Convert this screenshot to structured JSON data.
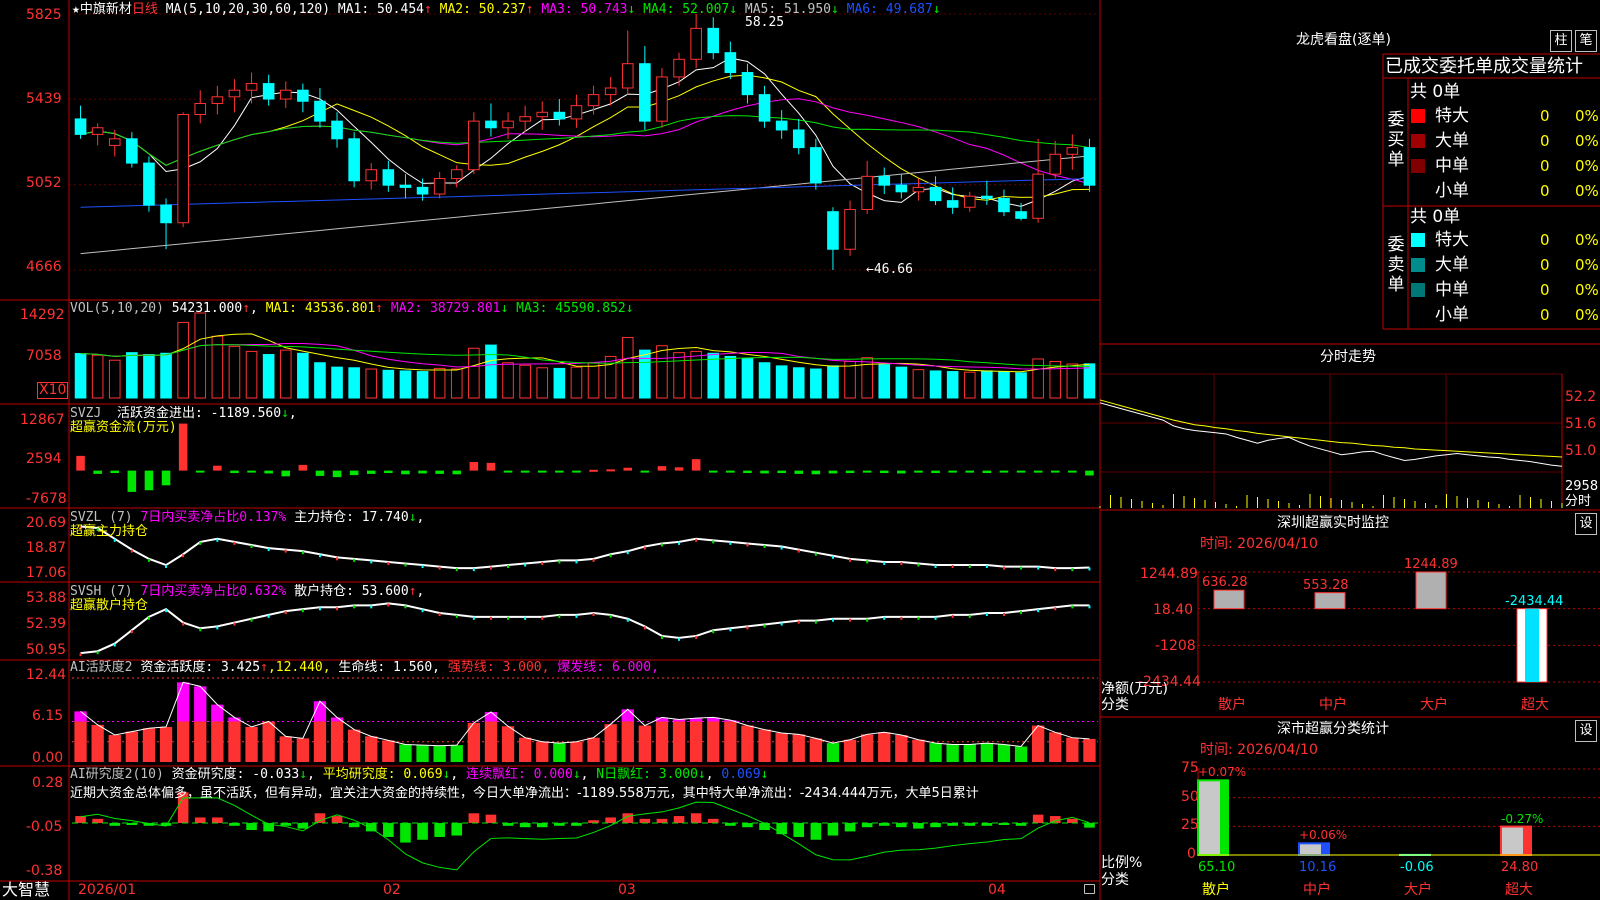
{
  "colors": {
    "up": "#ff3232",
    "down": "#00ffff",
    "bg": "#000000",
    "frame": "#c00000",
    "ma1": "#ffffff",
    "ma2": "#ffff00",
    "ma3": "#ff00ff",
    "ma4": "#00e600",
    "ma5": "#c0c0c0",
    "ma6": "#1e50ff",
    "magenta": "#ff00ff",
    "green": "#00e600"
  },
  "main": {
    "title_icon": "★",
    "stock": "中旗新材",
    "period": "日线",
    "ma_spec": "MA(5,10,20,30,60,120)",
    "ma1": "MA1: 50.454",
    "ma2": "MA2: 50.237",
    "ma3": "MA3: 50.743",
    "ma4": "MA4: 52.007",
    "ma5": "MA5: 51.950",
    "ma6": "MA6: 49.687",
    "ma1_arrow": "↑",
    "ma2_arrow": "↑",
    "ma3_arrow": "↓",
    "ma4_arrow": "↓",
    "ma5_arrow": "↓",
    "ma6_arrow": "↓",
    "hi_label": "58.25",
    "lo_label": "←46.66",
    "y_ticks": [
      "5825",
      "5439",
      "5052",
      "4666"
    ]
  },
  "vol": {
    "spec": "VOL(5,10,20)",
    "value": "54231.000",
    "arrow": "↑",
    "ma1": "MA1: 43536.801",
    "ma1_arrow": "↑",
    "ma2": "MA2: 38729.801",
    "ma2_arrow": "↓",
    "ma3": "MA3: 45590.852",
    "ma3_arrow": "↓",
    "y_ticks": [
      "14292",
      "7058"
    ],
    "unit": "X10"
  },
  "svzj": {
    "name": "SVZJ",
    "label": "活跃资金进出: -1189.560",
    "arrow": "↓",
    "suffix": ",",
    "sub": "超赢资金流(万元)",
    "y_ticks": [
      "12867",
      "2594",
      "-7678"
    ]
  },
  "svzl": {
    "name": "SVZL (7)",
    "label": "7日内买卖净占比0.137%",
    "hold": "主力持仓: 17.740",
    "arrow": "↓",
    "suffix": ",",
    "sub": "超赢主力持仓",
    "y_ticks": [
      "20.69",
      "18.87",
      "17.06"
    ]
  },
  "svsh": {
    "name": "SVSH (7)",
    "label": "7日内买卖净占比0.632%",
    "hold": "散户持仓: 53.600",
    "arrow": "↑",
    "suffix": ",",
    "sub": "超赢散户持仓",
    "y_ticks": [
      "53.88",
      "52.39",
      "50.95"
    ]
  },
  "ai1": {
    "name": "AI活跃度2",
    "a": "资金活跃度: 3.425",
    "a_arrow": "↑",
    "b": ",12.440,",
    "c": "生命线: 1.560,",
    "d": "强势线: 3.000,",
    "e": "爆发线: 6.000,",
    "y_ticks": [
      "12.44",
      "6.15",
      "0.00"
    ]
  },
  "ai2": {
    "name": "AI研究度2(10)",
    "a": "资金研究度: -0.033",
    "a_arrow": "↓",
    "b": "平均研究度: 0.069",
    "b_arrow": "↓",
    "c": "连续飘红: 0.000",
    "c_arrow": "↓",
    "d": "N日飘红: 3.000",
    "d_arrow": "↓",
    "e": "0.069",
    "e_arrow": "↓",
    "comment": "近期大资金总体偏多，虽不活跃，但有异动，宜关注大资金的持续性，今日大单净流出：-1189.558万元，其中特大单净流出：-2434.444万元，大单5日累计",
    "y_ticks": [
      "0.28",
      "-0.05",
      "-0.38"
    ]
  },
  "bottom": {
    "brand": "大智慧",
    "dates": [
      "2026/01",
      "02",
      "03",
      "04"
    ]
  },
  "lhb": {
    "title": "龙虎看盘(逐单)",
    "btn1": "柱",
    "btn2": "笔",
    "header": "已成交委托单成交量统计",
    "buy_label": "委买单",
    "sell_label": "委卖单",
    "buy_total": "共 0单",
    "sell_total": "共 0单",
    "buy_rows": [
      {
        "name": "特大",
        "v": "0",
        "p": "0%",
        "c": "#ff0000"
      },
      {
        "name": "大单",
        "v": "0",
        "p": "0%",
        "c": "#a00000"
      },
      {
        "name": "中单",
        "v": "0",
        "p": "0%",
        "c": "#800000"
      },
      {
        "name": "小单",
        "v": "0",
        "p": "0%",
        "c": "#000000"
      }
    ],
    "sell_rows": [
      {
        "name": "特大",
        "v": "0",
        "p": "0%",
        "c": "#00ffff"
      },
      {
        "name": "大单",
        "v": "0",
        "p": "0%",
        "c": "#008c8c"
      },
      {
        "name": "中单",
        "v": "0",
        "p": "0%",
        "c": "#007878"
      },
      {
        "name": "小单",
        "v": "0",
        "p": "0%",
        "c": "#000000"
      }
    ]
  },
  "fenshi": {
    "title": "分时走势",
    "y_ticks": [
      "52.2",
      "51.6",
      "51.0",
      "2958",
      "分时"
    ]
  },
  "sz1": {
    "title": "深圳超赢实时监控",
    "btn": "设",
    "time": "时间: 2026/04/10",
    "ylabel": "净额(万元)",
    "xlabel": "分类",
    "y_ticks": [
      "1244.89",
      "18.40",
      "-1208",
      "-2434.44"
    ]
  },
  "sz2": {
    "title": "深市超赢分类统计",
    "btn": "设",
    "time": "时间: 2026/04/10",
    "ylabel": "比例%",
    "xlabel": "分类",
    "y_ticks": [
      "75",
      "50",
      "25",
      "0"
    ]
  },
  "chart_data": [
    {
      "type": "candlestick",
      "title": "中旗新材 日线",
      "ylim": [
        46.66,
        58.25
      ],
      "y_ticks": [
        58.25,
        54.39,
        50.52,
        46.66
      ],
      "high": 58.25,
      "low": 46.66,
      "x_labels": [
        "2026/01",
        "02",
        "03",
        "04"
      ],
      "ohlc": [
        [
          53.5,
          54.1,
          52.6,
          52.8
        ],
        [
          52.8,
          53.3,
          52.3,
          53.1
        ],
        [
          52.3,
          53.0,
          51.8,
          52.6
        ],
        [
          52.6,
          52.9,
          51.3,
          51.5
        ],
        [
          51.5,
          51.8,
          49.3,
          49.6
        ],
        [
          49.6,
          49.9,
          47.6,
          48.8
        ],
        [
          48.8,
          53.8,
          48.6,
          53.7
        ],
        [
          53.7,
          54.8,
          53.3,
          54.2
        ],
        [
          54.2,
          55.0,
          53.7,
          54.5
        ],
        [
          54.5,
          55.3,
          53.8,
          54.8
        ],
        [
          54.8,
          55.6,
          54.2,
          55.1
        ],
        [
          55.1,
          55.5,
          54.1,
          54.4
        ],
        [
          54.4,
          55.2,
          54.0,
          54.8
        ],
        [
          54.8,
          55.1,
          53.8,
          54.3
        ],
        [
          54.3,
          54.9,
          53.1,
          53.4
        ],
        [
          53.4,
          53.8,
          52.2,
          52.6
        ],
        [
          52.6,
          52.9,
          50.4,
          50.7
        ],
        [
          50.7,
          51.5,
          50.3,
          51.2
        ],
        [
          51.2,
          51.6,
          50.2,
          50.5
        ],
        [
          50.5,
          51.0,
          49.9,
          50.4
        ],
        [
          50.4,
          50.8,
          49.8,
          50.1
        ],
        [
          50.1,
          51.1,
          49.9,
          50.8
        ],
        [
          50.8,
          51.4,
          50.4,
          51.2
        ],
        [
          51.2,
          53.8,
          51.0,
          53.4
        ],
        [
          53.4,
          54.2,
          52.7,
          53.1
        ],
        [
          53.1,
          53.8,
          52.6,
          53.4
        ],
        [
          53.4,
          54.1,
          52.9,
          53.6
        ],
        [
          53.6,
          54.3,
          53.0,
          53.8
        ],
        [
          53.8,
          54.4,
          53.2,
          53.5
        ],
        [
          53.5,
          54.6,
          53.1,
          54.1
        ],
        [
          54.1,
          55.0,
          53.7,
          54.6
        ],
        [
          54.6,
          55.4,
          54.1,
          54.9
        ],
        [
          54.9,
          57.5,
          54.6,
          56.0
        ],
        [
          56.0,
          56.8,
          53.0,
          53.4
        ],
        [
          53.4,
          55.8,
          53.1,
          55.4
        ],
        [
          55.4,
          56.5,
          55.0,
          56.2
        ],
        [
          56.2,
          58.25,
          55.8,
          57.6
        ],
        [
          57.6,
          58.1,
          56.2,
          56.5
        ],
        [
          56.5,
          57.0,
          55.3,
          55.6
        ],
        [
          55.6,
          56.0,
          54.2,
          54.6
        ],
        [
          54.6,
          55.0,
          53.1,
          53.4
        ],
        [
          53.4,
          53.9,
          52.6,
          53.0
        ],
        [
          53.0,
          53.5,
          51.9,
          52.2
        ],
        [
          52.2,
          52.6,
          50.3,
          50.6
        ],
        [
          49.3,
          49.5,
          46.66,
          47.6
        ],
        [
          47.6,
          49.8,
          47.3,
          49.4
        ],
        [
          49.4,
          51.6,
          49.2,
          50.9
        ],
        [
          50.9,
          51.3,
          50.1,
          50.5
        ],
        [
          50.5,
          51.0,
          49.9,
          50.2
        ],
        [
          50.2,
          50.8,
          49.8,
          50.4
        ],
        [
          50.4,
          50.9,
          49.6,
          49.8
        ],
        [
          49.8,
          50.4,
          49.2,
          49.5
        ],
        [
          49.5,
          50.2,
          49.3,
          50.0
        ],
        [
          50.0,
          50.7,
          49.6,
          49.9
        ],
        [
          49.9,
          50.3,
          49.1,
          49.3
        ],
        [
          49.3,
          49.7,
          48.9,
          49.0
        ],
        [
          49.0,
          52.6,
          48.8,
          51.0
        ],
        [
          51.0,
          52.5,
          50.8,
          51.9
        ],
        [
          51.9,
          52.8,
          51.2,
          52.2
        ],
        [
          52.2,
          52.6,
          50.2,
          50.5
        ]
      ]
    },
    {
      "type": "bar",
      "title": "VOL(5,10,20)",
      "ylim": [
        0,
        14292
      ],
      "y_ticks": [
        14292,
        7058
      ],
      "unit": "X10",
      "values": [
        7058,
        6800,
        6000,
        7200,
        6900,
        7100,
        12000,
        13500,
        9800,
        8200,
        7400,
        6900,
        7600,
        7100,
        5600,
        4900,
        4800,
        4600,
        4400,
        4300,
        4200,
        4700,
        4600,
        7900,
        8400,
        5600,
        5200,
        4800,
        4700,
        4900,
        5600,
        6600,
        9600,
        7600,
        8300,
        7200,
        7400,
        7100,
        6600,
        6300,
        5600,
        5100,
        4800,
        4600,
        5100,
        5800,
        6400,
        5300,
        4900,
        4500,
        4300,
        4200,
        4100,
        4300,
        4200,
        4000,
        6200,
        5800,
        5400,
        5423
      ]
    },
    {
      "type": "bar",
      "title": "超赢资金流(万元)",
      "ylim": [
        -7678,
        12867
      ],
      "y_ticks": [
        12867,
        2594,
        -7678
      ],
      "values": [
        3600,
        -800,
        -600,
        -5200,
        -4800,
        -3600,
        11500,
        -300,
        1200,
        -600,
        -400,
        -700,
        -1400,
        1400,
        -1300,
        -1600,
        -1100,
        -800,
        -600,
        -900,
        -700,
        -800,
        -900,
        2100,
        1900,
        -400,
        -500,
        -300,
        -400,
        -300,
        200,
        300,
        700,
        -300,
        1100,
        800,
        2800,
        -400,
        -500,
        -600,
        -700,
        -600,
        -800,
        -900,
        -700,
        -600,
        -500,
        -600,
        -700,
        -500,
        -600,
        -400,
        -500,
        -600,
        -400,
        -300,
        -500,
        -400,
        -300,
        -1190
      ]
    },
    {
      "type": "line",
      "title": "超赢主力持仓",
      "ylim": [
        17.06,
        20.69
      ],
      "y_ticks": [
        20.69,
        18.87,
        17.06
      ],
      "values": [
        20.4,
        20.3,
        19.6,
        18.9,
        18.3,
        17.9,
        18.6,
        19.4,
        19.6,
        19.4,
        19.2,
        19.0,
        18.9,
        18.8,
        18.6,
        18.4,
        18.3,
        18.2,
        18.1,
        18.0,
        17.9,
        17.8,
        17.7,
        17.7,
        17.8,
        17.9,
        18.0,
        18.1,
        18.2,
        18.2,
        18.3,
        18.6,
        18.8,
        19.1,
        19.3,
        19.4,
        19.6,
        19.5,
        19.4,
        19.3,
        19.2,
        19.1,
        18.9,
        18.7,
        18.5,
        18.3,
        18.2,
        18.1,
        18.1,
        18.0,
        17.9,
        17.9,
        17.9,
        17.9,
        17.8,
        17.8,
        17.8,
        17.7,
        17.7,
        17.74
      ]
    },
    {
      "type": "line",
      "title": "超赢散户持仓",
      "ylim": [
        50.95,
        53.88
      ],
      "y_ticks": [
        53.88,
        52.39,
        50.95
      ],
      "values": [
        51.1,
        51.2,
        51.6,
        52.3,
        53.0,
        53.4,
        52.7,
        52.4,
        52.5,
        52.7,
        52.9,
        53.1,
        53.3,
        53.4,
        53.5,
        53.5,
        53.6,
        53.6,
        53.7,
        53.6,
        53.4,
        53.2,
        53.1,
        53.0,
        53.0,
        53.0,
        53.0,
        53.0,
        53.1,
        53.1,
        53.2,
        53.1,
        52.9,
        52.5,
        52.0,
        51.9,
        52.0,
        52.3,
        52.4,
        52.5,
        52.6,
        52.7,
        52.8,
        52.8,
        52.9,
        52.9,
        52.9,
        53.0,
        53.0,
        53.0,
        53.0,
        53.1,
        53.1,
        53.2,
        53.2,
        53.3,
        53.4,
        53.5,
        53.6,
        53.6
      ]
    },
    {
      "type": "bar",
      "title": "AI活跃度2",
      "ylim": [
        0,
        12.44
      ],
      "y_ticks": [
        12.44,
        6.15,
        0.0
      ],
      "thresholds": [
        1.56,
        3.0,
        6.0
      ],
      "values": [
        7.5,
        5.5,
        4.0,
        4.5,
        5.0,
        5.2,
        11.8,
        11.2,
        8.5,
        6.6,
        5.2,
        6.0,
        3.8,
        3.5,
        9.0,
        6.6,
        4.8,
        3.8,
        3.2,
        2.6,
        2.5,
        2.4,
        2.5,
        5.8,
        7.4,
        5.3,
        3.6,
        3.0,
        2.8,
        3.0,
        3.6,
        5.6,
        7.8,
        5.4,
        6.6,
        6.3,
        6.5,
        6.6,
        6.2,
        5.4,
        4.8,
        4.3,
        4.1,
        3.5,
        2.8,
        3.3,
        4.1,
        4.4,
        4.0,
        3.3,
        2.8,
        2.6,
        2.6,
        2.8,
        2.6,
        2.3,
        5.4,
        4.4,
        3.6,
        3.425
      ]
    },
    {
      "type": "bar",
      "title": "AI研究度2(10)",
      "ylim": [
        -0.38,
        0.28
      ],
      "y_ticks": [
        0.28,
        -0.05,
        -0.38
      ],
      "values": [
        0.05,
        0.03,
        -0.02,
        -0.01,
        -0.02,
        -0.02,
        0.22,
        0.04,
        0.04,
        -0.02,
        -0.05,
        -0.06,
        -0.02,
        -0.04,
        0.07,
        0.05,
        -0.03,
        -0.06,
        -0.1,
        -0.14,
        -0.12,
        -0.1,
        -0.09,
        0.07,
        0.06,
        -0.02,
        -0.03,
        -0.03,
        -0.02,
        -0.02,
        0.02,
        0.04,
        0.07,
        0.03,
        0.03,
        0.05,
        0.07,
        0.03,
        -0.02,
        -0.03,
        -0.05,
        -0.08,
        -0.1,
        -0.12,
        -0.09,
        -0.06,
        -0.03,
        -0.02,
        -0.03,
        -0.04,
        -0.03,
        -0.02,
        -0.02,
        -0.02,
        -0.01,
        -0.02,
        0.06,
        0.05,
        0.03,
        -0.033
      ]
    },
    {
      "type": "bar",
      "title": "深圳超赢实时监控",
      "ylabel": "净额(万元)",
      "xlabel": "分类",
      "ylim": [
        -2434.44,
        1244.89
      ],
      "categories": [
        "散户",
        "中户",
        "大户",
        "超大"
      ],
      "values": [
        636.28,
        553.28,
        1244.89,
        -2434.44
      ],
      "labels": [
        "636.28",
        "553.28",
        "1244.89",
        "-2434.44"
      ]
    },
    {
      "type": "bar",
      "title": "深市超赢分类统计",
      "ylabel": "比例%",
      "xlabel": "分类",
      "ylim": [
        0,
        75
      ],
      "categories": [
        "散户",
        "中户",
        "大户",
        "超大"
      ],
      "values": [
        65.1,
        10.16,
        0.06,
        24.8
      ],
      "labels": [
        "65.10",
        "10.16",
        "-0.06",
        "24.80"
      ],
      "change": [
        "+0.07%",
        "+0.06%",
        "",
        "-0.27%"
      ]
    },
    {
      "type": "line",
      "title": "分时走势",
      "ylim": [
        50.7,
        52.4
      ],
      "y_ticks": [
        52.2,
        51.6,
        51.0
      ],
      "price": [
        51.9,
        51.85,
        51.8,
        51.75,
        51.7,
        51.65,
        51.6,
        51.5,
        51.45,
        51.42,
        51.4,
        51.38,
        51.36,
        51.3,
        51.25,
        51.2,
        51.25,
        51.28,
        51.3,
        51.22,
        51.15,
        51.1,
        51.05,
        51.0,
        51.02,
        51.05,
        51.06,
        51.0,
        50.95,
        50.9,
        50.92,
        50.95,
        50.98,
        51.0,
        51.02,
        51.0,
        50.98,
        50.96,
        50.95,
        50.92,
        50.9,
        50.88,
        50.85,
        50.82,
        50.8
      ],
      "avg": [
        51.95,
        51.9,
        51.85,
        51.8,
        51.75,
        51.7,
        51.65,
        51.6,
        51.56,
        51.52,
        51.5,
        51.47,
        51.45,
        51.42,
        51.4,
        51.37,
        51.35,
        51.33,
        51.31,
        51.29,
        51.27,
        51.25,
        51.23,
        51.21,
        51.2,
        51.18,
        51.16,
        51.15,
        51.13,
        51.12,
        51.1,
        51.09,
        51.08,
        51.07,
        51.06,
        51.05,
        51.04,
        51.03,
        51.02,
        51.01,
        51.0,
        50.99,
        50.98,
        50.97,
        50.96
      ]
    }
  ]
}
